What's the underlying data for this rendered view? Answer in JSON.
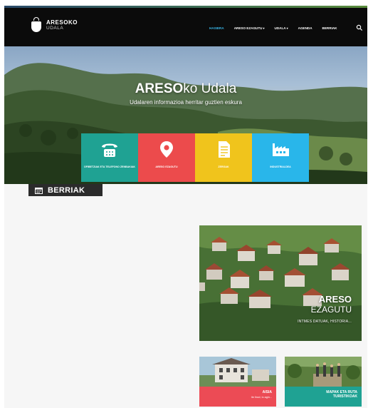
{
  "header": {
    "logo_line1": "ARESOKO",
    "logo_line2": "UDALA",
    "nav": [
      {
        "label": "HASIERA",
        "active": true
      },
      {
        "label": "ARESO EZAGUTU",
        "caret": "▾"
      },
      {
        "label": "UDALA",
        "caret": "▾"
      },
      {
        "label": "AGENDA"
      },
      {
        "label": "BERRIAK"
      }
    ],
    "search_icon": "search-icon",
    "accent_color": "#3ab6e8"
  },
  "hero": {
    "title_bold": "ARESO",
    "title_rest": "ko Udala",
    "subtitle": "Udalaren informazioa herritar guztien eskura"
  },
  "tiles": [
    {
      "label": "OFIBETZIAK ETA TELEFONO ZENBAKIAK",
      "icon": "phone-icon",
      "color": "#1fa293"
    },
    {
      "label": "ARESO EZAGUTU",
      "icon": "location-pin-icon",
      "color": "#ec4b4c"
    },
    {
      "label": "ZERGAK",
      "icon": "document-icon",
      "color": "#f0c41c"
    },
    {
      "label": "INDUSTRIALDEA",
      "icon": "factory-icon",
      "color": "#29b6ea"
    }
  ],
  "news_heading": {
    "label": "BERRIAK",
    "icon": "calendar-icon"
  },
  "promo": {
    "title_line1": "ARESO",
    "title_line2": "EZAGUTU",
    "subtitle": "INTMES DATUAK, HISTORIA..."
  },
  "cards": [
    {
      "title": "AISIA",
      "subtitle": "Ibr Ibod, lo agin...",
      "color": "#ec4b55"
    },
    {
      "title": "MAPAK ETA RUTA TURISTIKOAK",
      "subtitle": "",
      "color": "#1fa293"
    }
  ]
}
